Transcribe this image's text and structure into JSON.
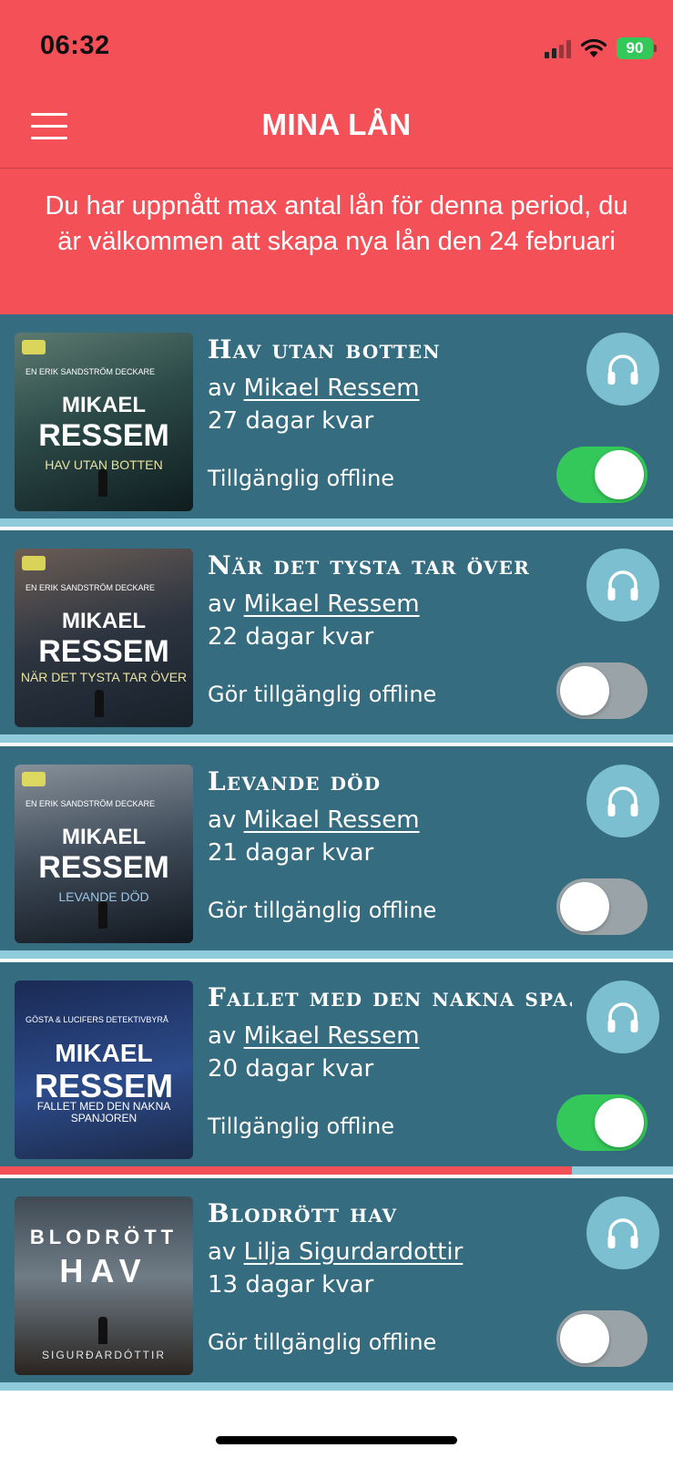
{
  "status_bar": {
    "time": "06:32",
    "battery": "90",
    "icons": [
      "signal-icon",
      "wifi-icon",
      "battery-icon"
    ]
  },
  "header": {
    "title": "MINA LÅN",
    "menu_icon": "hamburger-menu-icon"
  },
  "notice": {
    "text": "Du har uppnått max antal lån för denna period, du är välkommen att skapa nya lån den 24 februari"
  },
  "colors": {
    "accent": "#f35058",
    "row_background": "#356c7f",
    "listen_button": "#7bbfd0",
    "toggle_on": "#34c759",
    "toggle_off": "#9aa4a8",
    "progress_track": "#8fcbdb"
  },
  "loans": [
    {
      "title": "Hav utan botten",
      "by_prefix": "av",
      "author": "Mikael Ressem",
      "days_left": "27 dagar kvar",
      "offline_label": "Tillgänglig offline",
      "offline": true,
      "progress": 0,
      "cover": {
        "series": "En Erik Sandström Deckare",
        "author_first": "MIKAEL",
        "author_last": "RESSEM",
        "subtitle": "HAV UTAN BOTTEN"
      }
    },
    {
      "title": "När det tysta tar över",
      "by_prefix": "av",
      "author": "Mikael Ressem",
      "days_left": "22 dagar kvar",
      "offline_label": "Gör tillgänglig offline",
      "offline": false,
      "progress": 0,
      "cover": {
        "series": "En Erik Sandström Deckare",
        "author_first": "MIKAEL",
        "author_last": "RESSEM",
        "subtitle": "NÄR DET TYSTA TAR ÖVER"
      }
    },
    {
      "title": "Levande död",
      "by_prefix": "av",
      "author": "Mikael Ressem",
      "days_left": "21 dagar kvar",
      "offline_label": "Gör tillgänglig offline",
      "offline": false,
      "progress": 0,
      "cover": {
        "series": "En Erik Sandström Deckare",
        "author_first": "MIKAEL",
        "author_last": "RESSEM",
        "subtitle": "LEVANDE DÖD"
      }
    },
    {
      "title": "Fallet med den nakna spa...",
      "by_prefix": "av",
      "author": "Mikael Ressem",
      "days_left": "20 dagar kvar",
      "offline_label": "Tillgänglig offline",
      "offline": true,
      "progress": 0.85,
      "cover": {
        "series": "Gösta & Lucifers Detektivbyrå",
        "author_first": "MIKAEL",
        "author_last": "RESSEM",
        "subtitle": "FALLET MED DEN NAKNA SPANJOREN"
      }
    },
    {
      "title": "Blodrött hav",
      "by_prefix": "av",
      "author": "Lilja Sigurdardottir",
      "days_left": "13 dagar kvar",
      "offline_label": "Gör tillgänglig offline",
      "offline": false,
      "progress": 0,
      "cover": {
        "series": "",
        "author_first": "BLODRÖTT",
        "author_last": "HAV",
        "subtitle": "SIGURÐARDÓTTIR"
      }
    }
  ]
}
